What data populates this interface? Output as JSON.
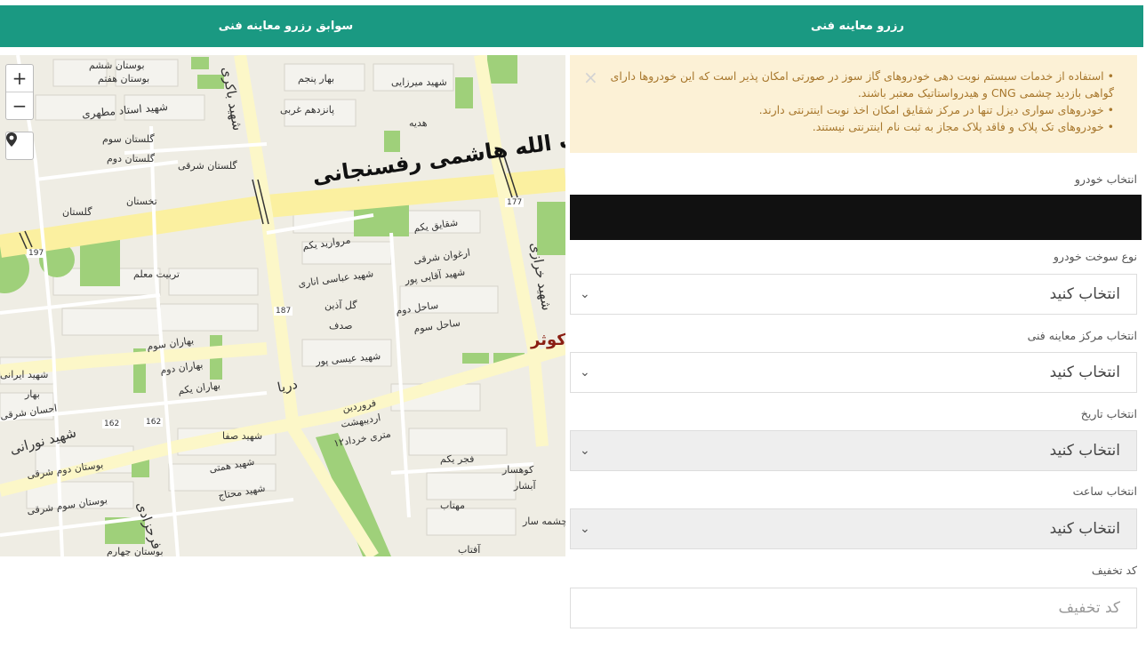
{
  "tabs": [
    {
      "label": "رزرو معاینه فنی"
    },
    {
      "label": "سوابق رزرو معاینه فنی"
    }
  ],
  "map": {
    "zoom_in": "+",
    "zoom_out": "−",
    "labels": {
      "main_road": "آیت الله هاشمی رفسنجانی",
      "kowsar": "کوثر",
      "darya": "دریا",
      "nourani": "شهید نورانی",
      "farahzadi": "فرحزادی",
      "shahid_bagheri": "شهید باکری",
      "shahid_kharrazi": "شهید خرازی",
      "bustan_shesham": "بوستان ششم",
      "bustan_haftom": "بوستان هفتم",
      "bahar_panjom": "بهار پنجم",
      "shahid_mirzaei": "شهید میرزایی",
      "ostad_motahari": "شهید استاد مطهری",
      "golestan_sevom": "گلستان سوم",
      "golestan_dovom": "گلستان دوم",
      "golestan_sharghi": "گلستان شرقی",
      "golestan": "گلستان",
      "takhtestan": "تخستان",
      "tarbiat_moallem": "تربیت معلم",
      "shaghayegh_yekom": "شقایق یکم",
      "morvarid_yekom": "مروارید یکم",
      "arghavan_sharghi": "ارغوان شرقی",
      "shahid_abbasi_anari": "شهید عباسی اناری",
      "shahid_aghaei_pour": "شهید آقایی پور",
      "sahel_dovom": "ساحل دوم",
      "sahel_sevom": "ساحل سوم",
      "gol_azin": "گل آذین",
      "sadaf": "صدف",
      "shahid_isa_pour": "شهید عیسی پور",
      "farvardin": "فروردین",
      "ordibehesht": "اردیبهشت",
      "khordad": "۱۲متری خرداد",
      "fajr_yekom": "فجر یکم",
      "kuhsar": "کوهسار",
      "abshar": "آبشار",
      "mahtab": "مهتاب",
      "cheshmeh_sar": "چشمه سار",
      "aftab": "آفتاب",
      "bahran_sevom": "بهاران سوم",
      "bahran_dovom": "بهاران دوم",
      "bahran_yekom": "بهاران یکم",
      "shahid_sefa": "شهید صفا",
      "shahid_hemmati": "شهید همتی",
      "shahid_mohtaj": "شهید محتاج",
      "bustan_dovom_sharghi": "بوستان دوم شرقی",
      "bustan_sevom_sharghi": "بوستان سوم شرقی",
      "bustan_chaharom": "بوستان چهارم",
      "ehsan_sharghi": "احسان شرقی",
      "shahid_irani": "شهید ایرانی",
      "bahar": "بهار",
      "panzdahom_gharbi": "پانزدهم غربی",
      "hedayat": "هدیه",
      "n187": "187",
      "n177": "177",
      "n197": "197",
      "n162a": "162",
      "n162b": "162"
    }
  },
  "alert": {
    "items": [
      "استفاده از خدمات سیستم نوبت دهی خودروهای گاز سوز در صورتی امکان پذیر است که این خودروها دارای گواهی بازدید چشمی CNG و هیدرواستاتیک معتبر باشند.",
      "خودروهای سواری دیزل تنها در مرکز شقایق امکان اخذ نوبت اینترنتی دارند.",
      "خودروهای تک پلاک و فاقد پلاک مجاز به ثبت نام اینترنتی نیستند."
    ],
    "close": "×"
  },
  "form": {
    "car_label": "انتخاب خودرو",
    "fuel_label": "نوع سوخت خودرو",
    "fuel_value": "انتخاب کنید",
    "center_label": "انتخاب مرکز معاینه فنی",
    "center_value": "انتخاب کنید",
    "date_label": "انتخاب تاریخ",
    "date_value": "انتخاب کنید",
    "time_label": "انتخاب ساعت",
    "time_value": "انتخاب کنید",
    "discount_label": "کد تخفیف",
    "discount_placeholder": "کد تخفیف"
  }
}
